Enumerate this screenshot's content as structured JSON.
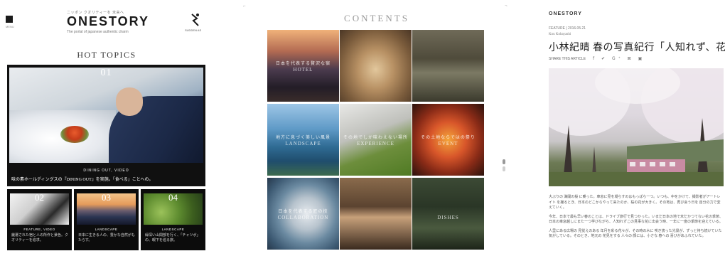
{
  "left": {
    "menu_label": "MENU",
    "brand_sub": "ニッポン クオリティーを 未来へ",
    "brand": "ONESTORY",
    "brand_tag": "The portal of japanese authentic charm",
    "shop_label": "SUDDEN AS",
    "section_title": "HOT TOPICS",
    "hero": {
      "number": "01",
      "category": "DINING OUT, VIDEO",
      "caption": "味の素ホールディングスの『DINING OUT』を実施。「食べる」ことへの。"
    },
    "subs": [
      {
        "number": "02",
        "category": "FEATURE, VIDEO",
        "caption": "厳選された宿と人の所作と景色。クオリティーを追求。"
      },
      {
        "number": "03",
        "category": "LANDSCAPE",
        "caption": "日本に生きる人の、豊かな自然がもたらす。"
      },
      {
        "number": "04",
        "category": "LANDSCAPE",
        "caption": "緑深い山間部を行く、「チャツボ」の、眼下を巡る旅。"
      }
    ]
  },
  "mid": {
    "title": "CONTENTS",
    "cells": [
      {
        "ja": "日本を代表する贅沢な宿",
        "label": "HOTEL"
      },
      {
        "ja": "",
        "label": ""
      },
      {
        "ja": "",
        "label": ""
      },
      {
        "ja": "地方に息づく美しい風景",
        "label": "LANDSCAPE"
      },
      {
        "ja": "その地でしか味わえない場所",
        "label": "EXPERIENCE"
      },
      {
        "ja": "その土地ならではの祭り",
        "label": "EVENT"
      },
      {
        "ja": "日本を代表する匠の技",
        "label": "COLLABORATION"
      },
      {
        "ja": "",
        "label": ""
      },
      {
        "ja": "",
        "label": "DISHES"
      }
    ]
  },
  "right": {
    "brand": "ONESTORY",
    "meta": "FEATURE | 2016.05.21",
    "author": "Kou Kobayashi",
    "title": "小林紀晴 春の写真紀行「人知れず、花」。",
    "share_label": "SHARE THIS ARTICLE",
    "share_icons": "f ✔ G⁺ ⊠ ▣",
    "paragraphs": [
      "大ぶりの 満開の桜 に乗った。車窓に見を凝らすのはもっぱら一つ。いつも、中をかけて、撮影者がアートレイト を撮るとき、日本のどこからやって来たのか、桜の花が大きく。その地は、再び会う日を 自分の力で変えていく。",
      "今年、日本で最も早い春のことは、ドライブ旅行で見つかった。いまだ日本の地で未だかつてない花の季節、日本の車窓越しにまた一つ学びながら、人知れずこの見事な花に出会う時、一年に一度の季節を迎えている。",
      "人里にある広場の 見覚えのある 年月を彩る花々が、その時の木に 咲き誇った光景が、ずっと待ち続けていた気がしている。そのとき、地元の 花見をする 人々の 顔には、小さな 春への 喜びがあふれていた。"
    ]
  }
}
